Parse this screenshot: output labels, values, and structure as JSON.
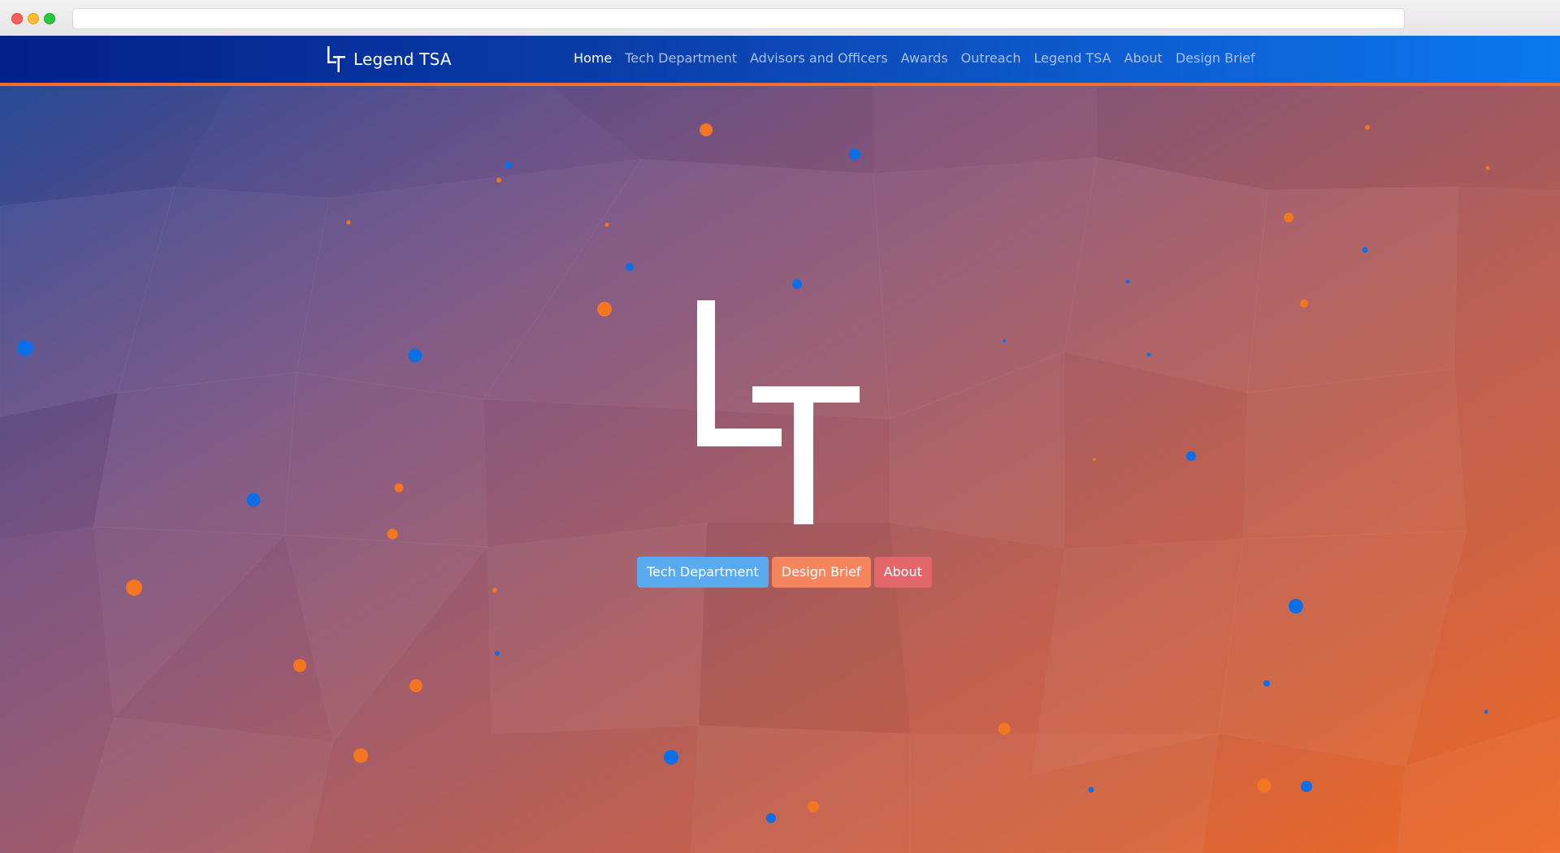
{
  "browser": {
    "url": ""
  },
  "navbar": {
    "brand_text": "Legend TSA",
    "brand_logo": "LT-logo-icon",
    "links": [
      {
        "label": "Home",
        "active": true
      },
      {
        "label": "Tech Department",
        "active": false
      },
      {
        "label": "Advisors and Officers",
        "active": false
      },
      {
        "label": "Awards",
        "active": false
      },
      {
        "label": "Outreach",
        "active": false
      },
      {
        "label": "Legend TSA",
        "active": false
      },
      {
        "label": "About",
        "active": false
      },
      {
        "label": "Design Brief",
        "active": false
      }
    ],
    "accent_color": "#f36f2b"
  },
  "hero": {
    "logo": "LT-logo-icon",
    "buttons": [
      {
        "label": "Tech Department",
        "color": "#5aaaf0"
      },
      {
        "label": "Design Brief",
        "color": "#f4855c"
      },
      {
        "label": "About",
        "color": "#e3666a"
      }
    ],
    "particle_colors": {
      "orange": "#f47621",
      "blue": "#0d6fe8"
    }
  }
}
